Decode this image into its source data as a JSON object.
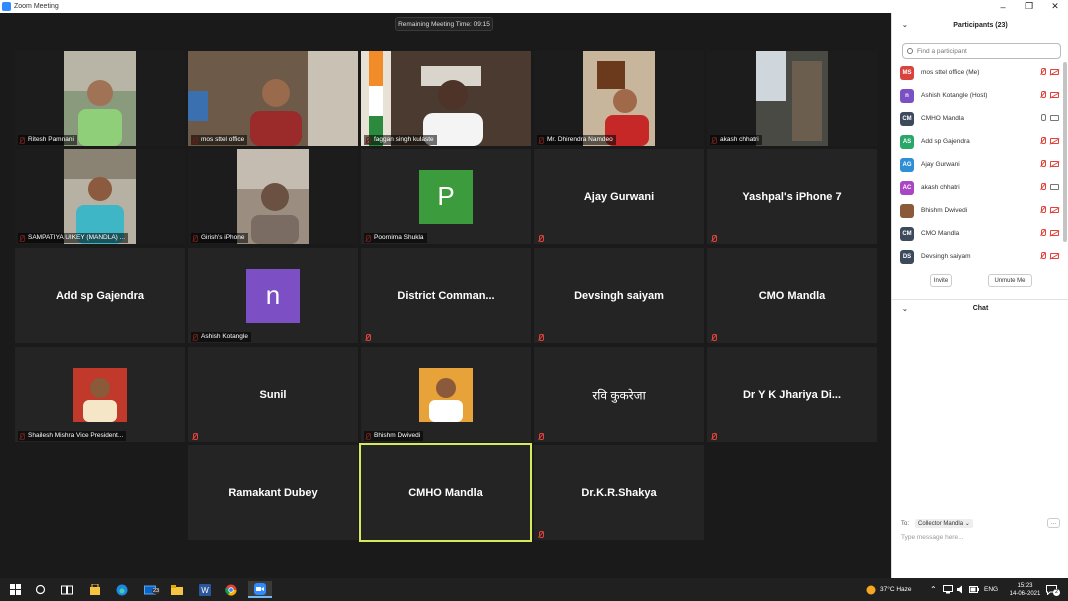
{
  "window": {
    "title": "Zoom Meeting"
  },
  "timer": "Remaining Meeting Time: 09:15",
  "tiles": [
    {
      "label": "Ritesh Pamnani"
    },
    {
      "label": "mos sttel office"
    },
    {
      "label": "faggan singh kulaste"
    },
    {
      "label": "Mr. Dhirendra Namdeo"
    },
    {
      "label": "akash chhatri"
    },
    {
      "label": "SAMPATIYA UIKEY (MANDLA) ..."
    },
    {
      "label": "Girish's iPhone"
    },
    {
      "label": "Poornima Shukla",
      "avatar": "P"
    },
    {
      "big": "Ajay Gurwani"
    },
    {
      "big": "Yashpal's iPhone 7"
    },
    {
      "big": "Add sp Gajendra"
    },
    {
      "label": "Ashish Kotangle",
      "avatar": "n"
    },
    {
      "big": "District  Comman..."
    },
    {
      "big": "Devsingh saiyam"
    },
    {
      "big": "CMO Mandla"
    },
    {
      "label": "Shailesh Mishra Vice President..."
    },
    {
      "big": "Sunil"
    },
    {
      "label": "Bhishm Dwivedi"
    },
    {
      "big": "रवि कुकरेजा"
    },
    {
      "big": "Dr Y K Jhariya Di..."
    },
    {
      "big": "Ramakant Dubey"
    },
    {
      "big": "CMHO Mandla"
    },
    {
      "big": "Dr.K.R.Shakya"
    }
  ],
  "participants_panel": {
    "title": "Participants (23)",
    "search_placeholder": "Find a participant",
    "list": [
      {
        "initials": "MS",
        "name": "mos sttel office (Me)",
        "color": "#d9433e"
      },
      {
        "initials": "n",
        "name": "Ashish Kotangle (Host)",
        "color": "#7c4fc4"
      },
      {
        "initials": "CM",
        "name": "CMHO Mandla",
        "color": "#3c4a5c"
      },
      {
        "initials": "AS",
        "name": "Add sp Gajendra",
        "color": "#2aa868"
      },
      {
        "initials": "AG",
        "name": "Ajay Gurwani",
        "color": "#2e8fd6"
      },
      {
        "initials": "AC",
        "name": "akash chhatri",
        "color": "#a846c4"
      },
      {
        "initials": "",
        "name": "Bhishm Dwivedi",
        "color": "#8a5a3a"
      },
      {
        "initials": "CM",
        "name": "CMO Mandla",
        "color": "#3c4a5c"
      },
      {
        "initials": "DS",
        "name": "Devsingh saiyam",
        "color": "#3c4a5c"
      }
    ],
    "invite_label": "Invite",
    "unmute_label": "Unmute Me"
  },
  "chat": {
    "title": "Chat",
    "to_label": "To:",
    "to_value": "Collector Mandla",
    "input_placeholder": "Type message here...",
    "more": "..."
  },
  "taskbar": {
    "weather": "37°C  Haze",
    "lang": "ENG",
    "time": "15:23",
    "date": "14-06-2021",
    "badge": "23",
    "notif": "2"
  }
}
